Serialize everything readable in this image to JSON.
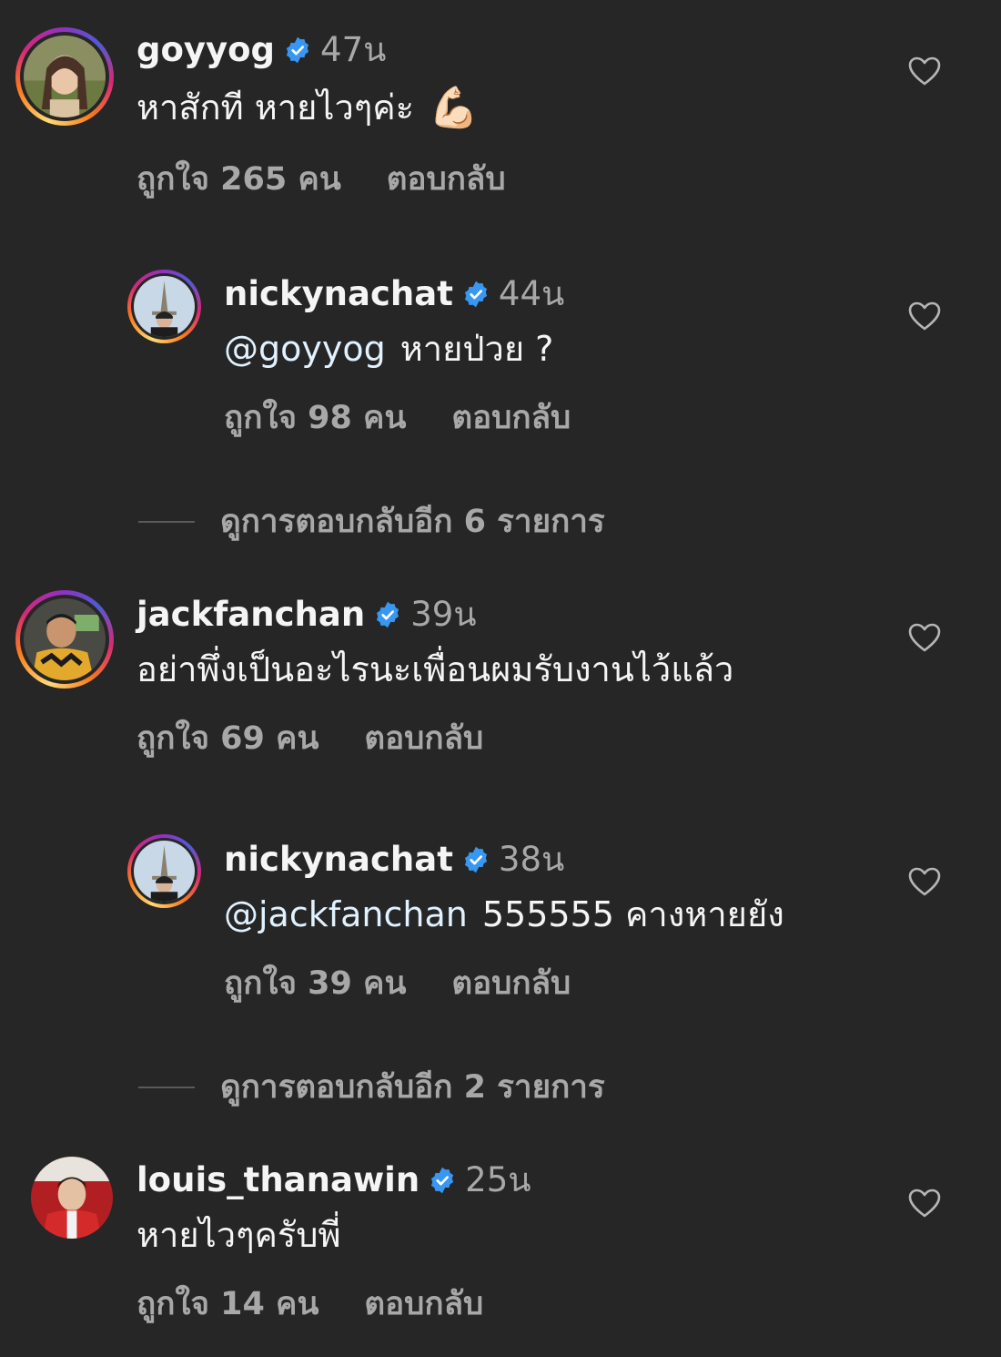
{
  "comments": [
    {
      "username": "goyyog",
      "time": "47น",
      "text": "หาสักที หายไวๆค่ะ",
      "emoji": "💪🏻",
      "likes": "ถูกใจ 265 คน",
      "reply": "ตอบกลับ"
    },
    {
      "username": "nickynachat",
      "time": "44น",
      "mention": "@goyyog",
      "text": "หายป่วย ?",
      "likes": "ถูกใจ 98 คน",
      "reply": "ตอบกลับ"
    },
    {
      "username": "jackfanchan",
      "time": "39น",
      "text": "อย่าพึ่งเป็นอะไรนะเพื่อนผมรับงานไว้แล้ว",
      "likes": "ถูกใจ 69 คน",
      "reply": "ตอบกลับ"
    },
    {
      "username": "nickynachat",
      "time": "38น",
      "mention": "@jackfanchan",
      "text": "555555 คางหายยัง",
      "likes": "ถูกใจ 39 คน",
      "reply": "ตอบกลับ"
    },
    {
      "username": "louis_thanawin",
      "time": "25น",
      "text": "หายไวๆครับพี่",
      "likes": "ถูกใจ 14 คน",
      "reply": "ตอบกลับ"
    }
  ],
  "more_replies": [
    "ดูการตอบกลับอีก 6 รายการ",
    "ดูการตอบกลับอีก 2 รายการ"
  ],
  "colors": {
    "background": "#262626",
    "verified": "#3897f0",
    "secondary_text": "#a8a8a8"
  }
}
